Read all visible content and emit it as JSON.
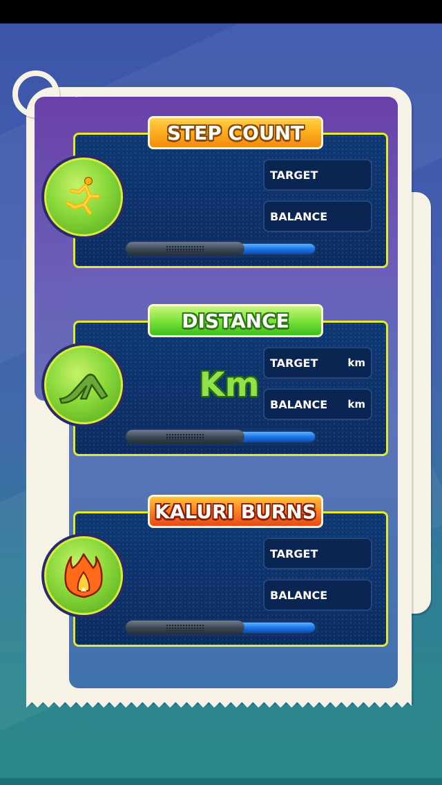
{
  "sections": {
    "steps": {
      "title": "STEP COUNT",
      "target_label": "TARGET",
      "balance_label": "BALANCE",
      "target_unit": "",
      "balance_unit": "",
      "icon": "runner-icon"
    },
    "distance": {
      "title": "DISTANCE",
      "unit_big": "Km",
      "target_label": "TARGET",
      "balance_label": "BALANCE",
      "target_unit": "km",
      "balance_unit": "km",
      "icon": "slide-icon"
    },
    "calories": {
      "title": "KALURI BURNS",
      "target_label": "TARGET",
      "balance_label": "BALANCE",
      "target_unit": "",
      "balance_unit": "",
      "icon": "flame-icon"
    }
  },
  "colors": {
    "banner_orange": "#ffb020",
    "banner_green": "#7ee23e",
    "banner_red": "#ff8020",
    "panel_border": "#e2ea2c",
    "panel_fill": "#0f3873",
    "progress_fill": "#1f78e8"
  }
}
